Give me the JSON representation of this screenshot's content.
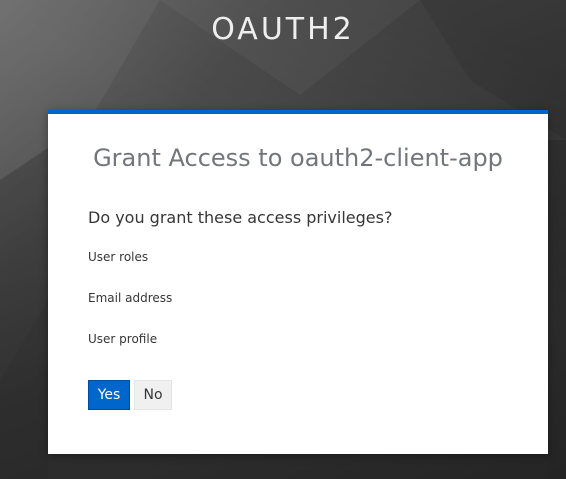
{
  "header": {
    "brand": "OAUTH2"
  },
  "consent": {
    "title": "Grant Access to oauth2-client-app",
    "question": "Do you grant these access privileges?",
    "privileges": [
      {
        "label": "User roles"
      },
      {
        "label": "Email address"
      },
      {
        "label": "User profile"
      }
    ],
    "actions": {
      "yes_label": "Yes",
      "no_label": "No"
    }
  },
  "colors": {
    "accent": "#0066cc",
    "background": "#3f3f3f",
    "card": "#ffffff"
  }
}
